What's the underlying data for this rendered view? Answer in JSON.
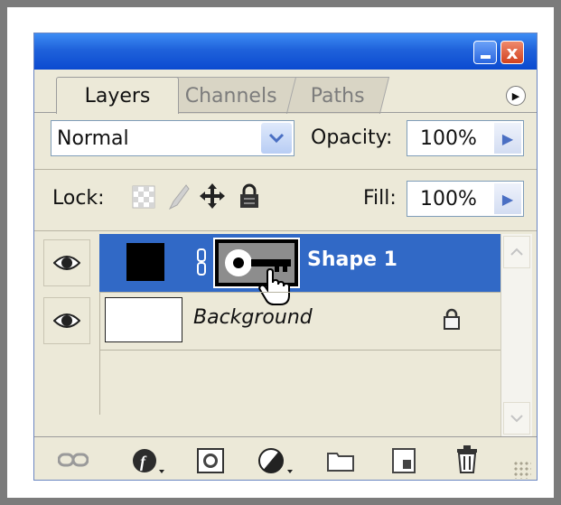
{
  "window": {
    "minimize_icon": "minimize-icon",
    "close_icon": "close-icon",
    "close_label": "x"
  },
  "tabs": [
    {
      "label": "Layers",
      "active": true
    },
    {
      "label": "Channels",
      "active": false
    },
    {
      "label": "Paths",
      "active": false
    }
  ],
  "panel_menu_icon": "play-icon",
  "blend_mode": {
    "value": "Normal"
  },
  "opacity": {
    "label": "Opacity:",
    "value": "100%"
  },
  "lock": {
    "label": "Lock:",
    "icons": [
      "lock-transparency-icon",
      "lock-image-icon",
      "lock-position-icon",
      "lock-all-icon"
    ]
  },
  "fill": {
    "label": "Fill:",
    "value": "100%"
  },
  "layers": [
    {
      "name": "Shape 1",
      "selected": true,
      "visible": true
    },
    {
      "name": "Background",
      "selected": false,
      "visible": true,
      "locked": true
    }
  ],
  "bottom_icons": [
    "link-layers-icon",
    "layer-style-icon",
    "layer-mask-icon",
    "adjustment-layer-icon",
    "new-group-icon",
    "new-layer-icon",
    "delete-layer-icon"
  ],
  "colors": {
    "titlebar": "#1f62db",
    "selection": "#3169c6",
    "panel_bg": "#ece9d8"
  }
}
